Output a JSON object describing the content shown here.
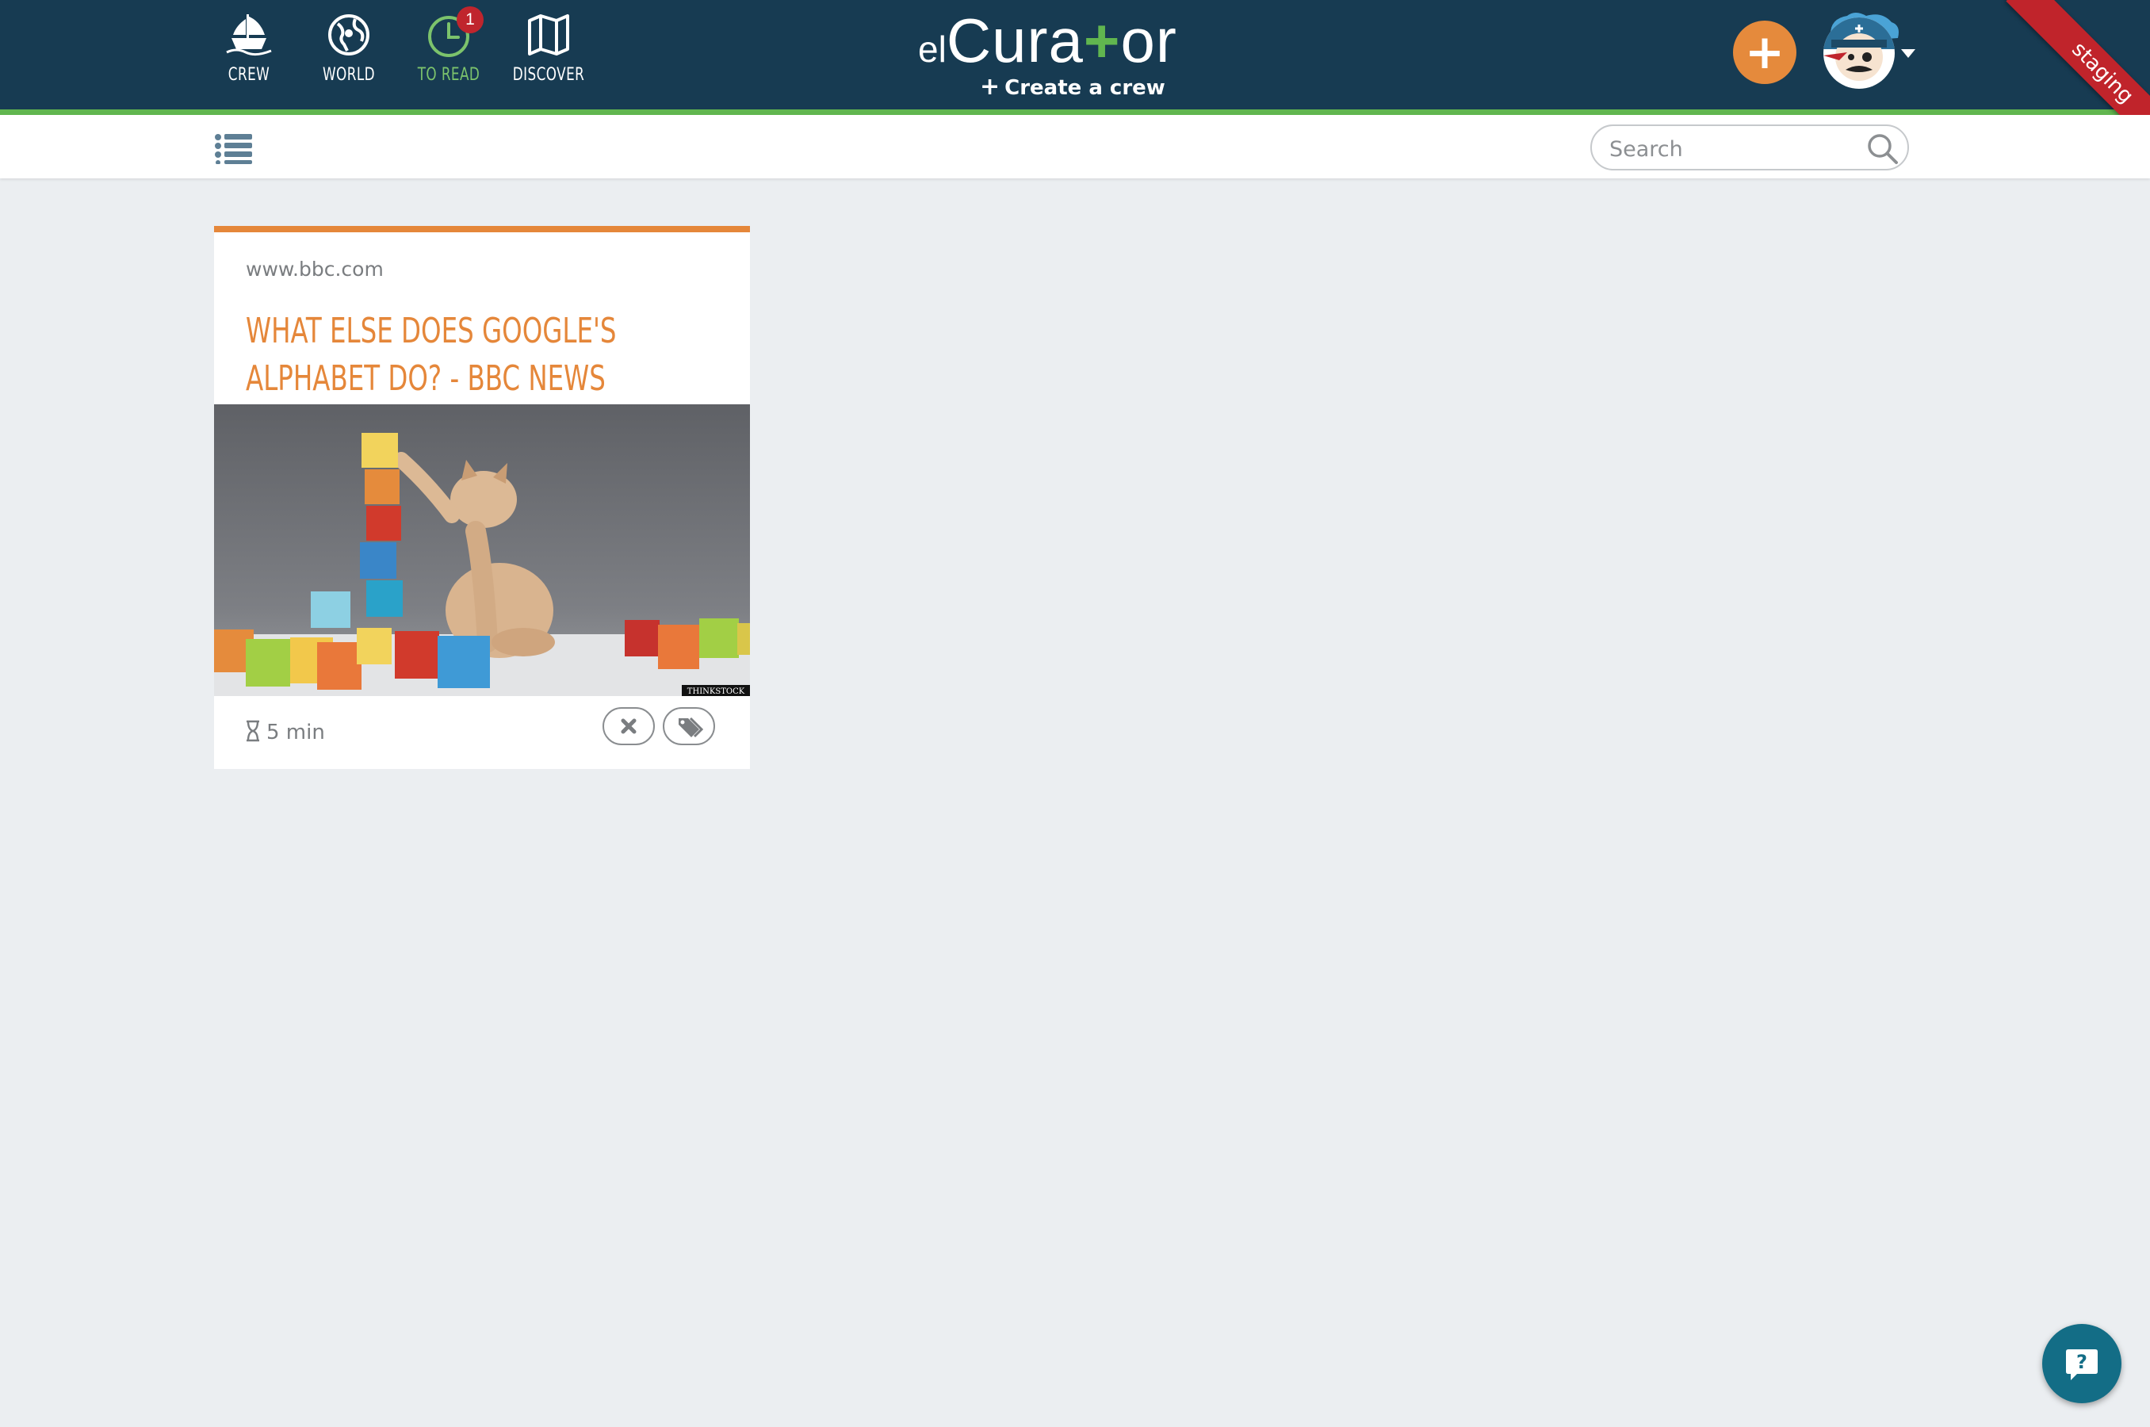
{
  "nav": {
    "items": [
      {
        "label": "CREW",
        "icon": "ship-icon"
      },
      {
        "label": "WORLD",
        "icon": "globe-icon"
      },
      {
        "label": "TO READ",
        "icon": "clock-icon",
        "badge": "1",
        "active": true
      },
      {
        "label": "DISCOVER",
        "icon": "map-icon"
      }
    ]
  },
  "logo": {
    "prefix": "el",
    "name_part1": "Cura",
    "name_plus": "+",
    "name_part2": "or"
  },
  "create_crew": {
    "icon": "+",
    "label": "Create a crew"
  },
  "actions": {
    "add_label": "+",
    "add_color": "#e58a3c"
  },
  "ribbon": {
    "label": "staging",
    "color": "#c0242b"
  },
  "search": {
    "placeholder": "Search",
    "value": ""
  },
  "card": {
    "domain": "www.bbc.com",
    "title": "What else does Google's Alphabet do? - BBC News",
    "image_credit": "THINKSTOCK",
    "read_time": "5 min",
    "accent_color": "#e5873a"
  },
  "colors": {
    "header": "#173b52",
    "accent_green": "#61b64f",
    "background": "#ebeef1",
    "help": "#136d86"
  }
}
